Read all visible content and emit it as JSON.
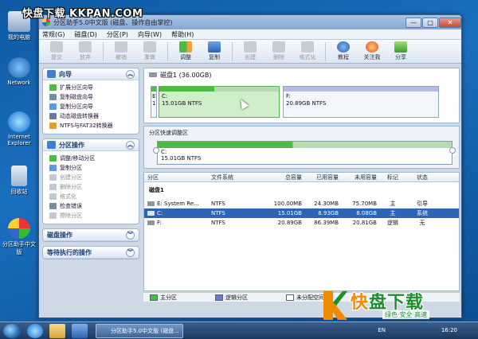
{
  "watermark": {
    "top": "快盘下载 KKPAN.COM",
    "brand_a": "快",
    "brand_b": "盘下载",
    "slogan": "绿色·安全·高速"
  },
  "desktop": {
    "icons": [
      {
        "label": "我的电脑"
      },
      {
        "label": "Network"
      },
      {
        "label": "Internet Explorer"
      },
      {
        "label": "回收站"
      },
      {
        "label": "分区助手中文版"
      }
    ]
  },
  "window": {
    "title": "分区助手5.0中文版 (磁盘、操作自由掌控)",
    "controls": {
      "min": "—",
      "max": "□",
      "close": "✕"
    }
  },
  "menu": [
    "常规(G)",
    "磁盘(D)",
    "分区(P)",
    "向导(W)",
    "帮助(H)"
  ],
  "toolbar": {
    "commit": "提交",
    "discard": "放弃",
    "undo": "撤销",
    "redo": "重做",
    "adjust": "调整",
    "copy": "复制",
    "create": "创建",
    "delete": "删除",
    "format": "格式化",
    "tutorial": "教程",
    "follow": "关注我",
    "share": "分享"
  },
  "left": {
    "wizard": {
      "title": "向导",
      "items": [
        "扩展分区向导",
        "复制磁盘向导",
        "复制分区向导",
        "动态磁盘转换器",
        "NTFS与FAT32转换器"
      ]
    },
    "partition_ops": {
      "title": "分区操作",
      "items": [
        "调整/移动分区",
        "复制分区",
        "创建分区",
        "删除分区",
        "格式化",
        "检查错误",
        "擦除分区"
      ],
      "disabled": [
        false,
        false,
        true,
        true,
        true,
        false,
        true
      ]
    },
    "disk_ops": {
      "title": "磁盘操作"
    },
    "pending": {
      "title": "等待执行的操作"
    }
  },
  "disk_map": {
    "title": "磁盘1 (36.00GB)",
    "small_label_top": "E",
    "small_label_bottom": "1",
    "c_label": "C:",
    "c_size": "15.01GB NTFS",
    "f_label": "F:",
    "f_size": "20.89GB NTFS",
    "c_used_pct": 46
  },
  "resize": {
    "title": "分区快速调整区",
    "label": "C:",
    "size": "15.01GB NTFS"
  },
  "table": {
    "headers": [
      "分区",
      "文件系统",
      "总容量",
      "已用容量",
      "未用容量",
      "标记",
      "状态"
    ],
    "disk_label": "磁盘1",
    "rows": [
      {
        "name": "E: System Re...",
        "fs": "NTFS",
        "total": "100.00MB",
        "used": "24.30MB",
        "free": "75.70MB",
        "flag": "主",
        "status": "引导",
        "selected": false
      },
      {
        "name": "C:",
        "fs": "NTFS",
        "total": "15.01GB",
        "used": "6.93GB",
        "free": "8.08GB",
        "flag": "主",
        "status": "系统",
        "selected": true
      },
      {
        "name": "F:",
        "fs": "NTFS",
        "total": "20.89GB",
        "used": "86.39MB",
        "free": "20.81GB",
        "flag": "逻辑",
        "status": "无",
        "selected": false
      }
    ]
  },
  "legend": {
    "primary": "主分区",
    "logical": "逻辑分区",
    "unallocated": "未分配空间"
  },
  "taskbar": {
    "task": "分区助手5.0中文版 (磁盘...",
    "lang": "EN",
    "time": "16:20"
  },
  "colors": {
    "primary": "#4dbb43",
    "logical": "#6c78d6",
    "unallocated": "#ffffff",
    "selected": "#2f63b3"
  }
}
